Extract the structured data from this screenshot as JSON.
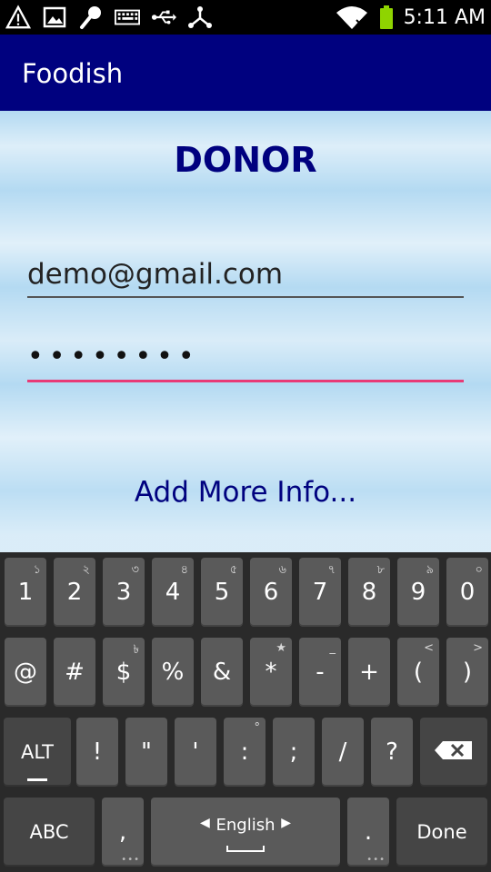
{
  "status_bar": {
    "time": "5:11 AM",
    "left_icons": [
      "warning-icon",
      "image-icon",
      "microphone-icon",
      "keyboard-icon",
      "usb-icon",
      "share-icon"
    ],
    "right_icons": [
      "wifi-icon",
      "battery-icon"
    ]
  },
  "app": {
    "title": "Foodish"
  },
  "form": {
    "heading": "DONOR",
    "email_value": "demo@gmail.com",
    "password_mask": "••••••••",
    "add_more_link": "Add More Info..."
  },
  "keyboard": {
    "row1": [
      {
        "main": "1",
        "sup": "১"
      },
      {
        "main": "2",
        "sup": "২"
      },
      {
        "main": "3",
        "sup": "৩"
      },
      {
        "main": "4",
        "sup": "৪"
      },
      {
        "main": "5",
        "sup": "৫"
      },
      {
        "main": "6",
        "sup": "৬"
      },
      {
        "main": "7",
        "sup": "৭"
      },
      {
        "main": "8",
        "sup": "৮"
      },
      {
        "main": "9",
        "sup": "৯"
      },
      {
        "main": "0",
        "sup": "০"
      }
    ],
    "row2": [
      {
        "main": "@",
        "sup": ""
      },
      {
        "main": "#",
        "sup": ""
      },
      {
        "main": "$",
        "sup": "৳"
      },
      {
        "main": "%",
        "sup": ""
      },
      {
        "main": "&",
        "sup": ""
      },
      {
        "main": "*",
        "sup": "★"
      },
      {
        "main": "-",
        "sup": "_"
      },
      {
        "main": "+",
        "sup": ""
      },
      {
        "main": "(",
        "sup": "<"
      },
      {
        "main": ")",
        "sup": ">"
      }
    ],
    "row3": [
      {
        "main": "ALT",
        "sup": ""
      },
      {
        "main": "!",
        "sup": ""
      },
      {
        "main": "\"",
        "sup": ""
      },
      {
        "main": "'",
        "sup": ""
      },
      {
        "main": ":",
        "sup": "°"
      },
      {
        "main": ";",
        "sup": ""
      },
      {
        "main": "/",
        "sup": ""
      },
      {
        "main": "?",
        "sup": ""
      }
    ],
    "row4": {
      "abc": "ABC",
      "comma": ",",
      "language": "English",
      "period": ".",
      "done": "Done"
    }
  }
}
